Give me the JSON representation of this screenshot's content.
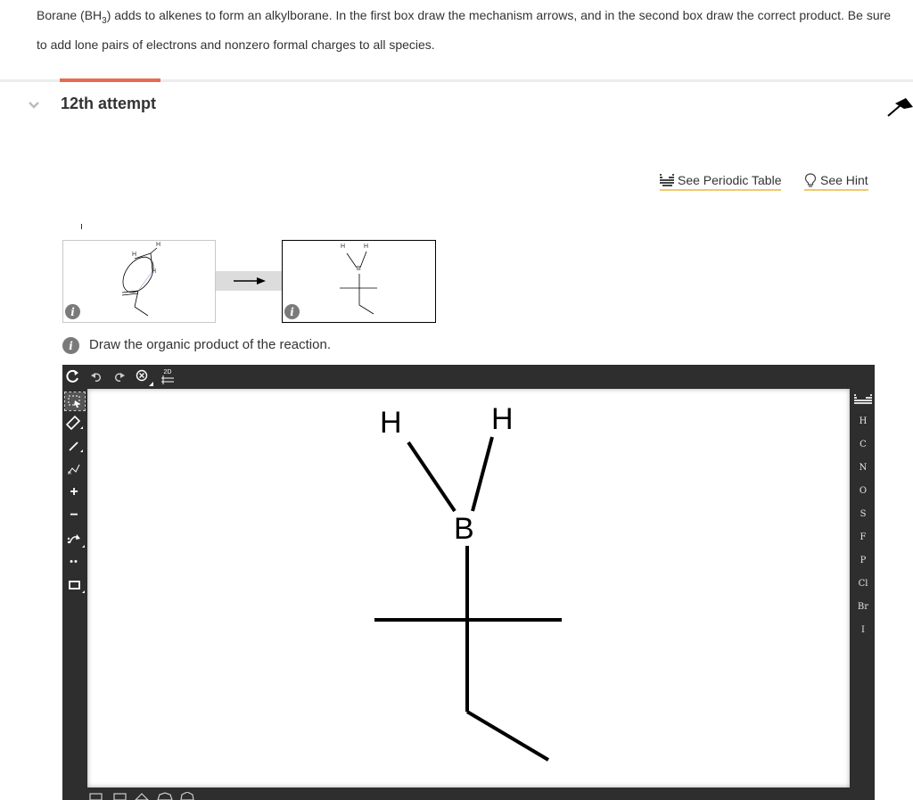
{
  "question": {
    "text_before": "Borane (BH",
    "subscript": "3",
    "text_after": ") adds to alkenes to form an alkylborane. In the first box draw the mechanism arrows, and in the second box draw the correct product. Be sure to add lone pairs of electrons and nonzero formal charges to all species."
  },
  "attempt": {
    "label": "12th attempt"
  },
  "links": {
    "periodic_table": "See Periodic Table",
    "hint": "See Hint"
  },
  "reaction": {
    "box1_atoms": [
      "H",
      "H",
      "H"
    ],
    "box2_atoms": [
      "H",
      "H",
      "B"
    ],
    "info_glyph": "i"
  },
  "instruction": {
    "text": "Draw the organic product of the reaction."
  },
  "editor": {
    "top_tools": [
      "refresh-icon",
      "undo-icon",
      "redo-icon",
      "zoom-icon",
      "2d-clean-icon"
    ],
    "clean_label": "2D",
    "left_tools": [
      {
        "icon": "select-icon"
      },
      {
        "icon": "eraser-icon"
      },
      {
        "icon": "bond-icon"
      },
      {
        "icon": "chain-icon"
      },
      {
        "icon": "positive-charge-icon",
        "glyph": "+"
      },
      {
        "icon": "negative-charge-icon",
        "glyph": "−"
      },
      {
        "icon": "arrow-icon"
      },
      {
        "icon": "lone-pair-icon",
        "glyph": "••"
      },
      {
        "icon": "shape-icon"
      }
    ],
    "elements": [
      "H",
      "C",
      "N",
      "O",
      "S",
      "F",
      "P",
      "Cl",
      "Br",
      "I"
    ],
    "molecule_atoms": {
      "h_left": "H",
      "h_right": "H",
      "boron": "B"
    }
  },
  "colors": {
    "accent": "#e86a50",
    "link_underline": "#f0c96c",
    "editor_bg": "#2e2e2e"
  }
}
